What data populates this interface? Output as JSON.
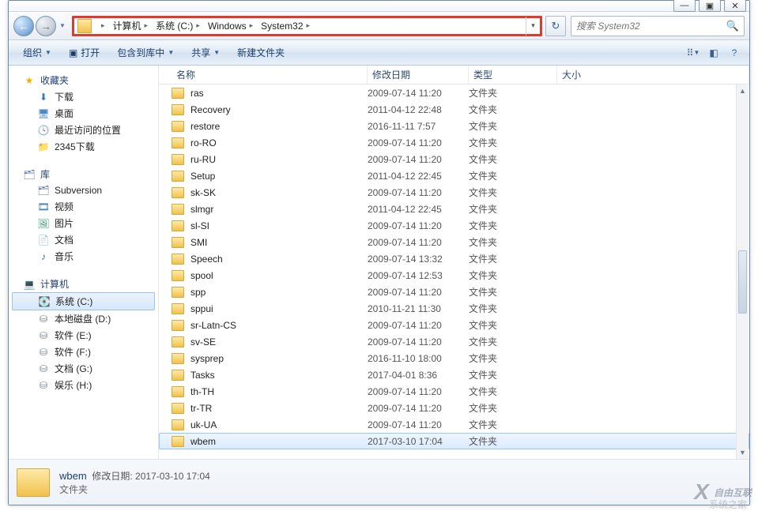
{
  "window_controls": {
    "min": "—",
    "max": "▣",
    "close": "✕"
  },
  "breadcrumbs": [
    "计算机",
    "系统 (C:)",
    "Windows",
    "System32"
  ],
  "search": {
    "placeholder": "搜索 System32"
  },
  "toolbar": {
    "organize": "组织",
    "open": "打开",
    "include": "包含到库中",
    "share": "共享",
    "newfolder": "新建文件夹"
  },
  "columns": {
    "name": "名称",
    "modified": "修改日期",
    "type": "类型",
    "size": "大小"
  },
  "sidebar": {
    "favorites": {
      "label": "收藏夹",
      "items": [
        "下载",
        "桌面",
        "最近访问的位置",
        "2345下载"
      ]
    },
    "libraries": {
      "label": "库",
      "items": [
        "Subversion",
        "视频",
        "图片",
        "文档",
        "音乐"
      ]
    },
    "computer": {
      "label": "计算机",
      "items": [
        "系统 (C:)",
        "本地磁盘 (D:)",
        "软件 (E:)",
        "软件 (F:)",
        "文档 (G:)",
        "娱乐 (H:)"
      ]
    }
  },
  "type_folder": "文件夹",
  "files": [
    {
      "n": "ras",
      "d": "2009-07-14 11:20"
    },
    {
      "n": "Recovery",
      "d": "2011-04-12 22:48"
    },
    {
      "n": "restore",
      "d": "2016-11-11 7:57"
    },
    {
      "n": "ro-RO",
      "d": "2009-07-14 11:20"
    },
    {
      "n": "ru-RU",
      "d": "2009-07-14 11:20"
    },
    {
      "n": "Setup",
      "d": "2011-04-12 22:45"
    },
    {
      "n": "sk-SK",
      "d": "2009-07-14 11:20"
    },
    {
      "n": "slmgr",
      "d": "2011-04-12 22:45"
    },
    {
      "n": "sl-SI",
      "d": "2009-07-14 11:20"
    },
    {
      "n": "SMI",
      "d": "2009-07-14 11:20"
    },
    {
      "n": "Speech",
      "d": "2009-07-14 13:32"
    },
    {
      "n": "spool",
      "d": "2009-07-14 12:53"
    },
    {
      "n": "spp",
      "d": "2009-07-14 11:20"
    },
    {
      "n": "sppui",
      "d": "2010-11-21 11:30"
    },
    {
      "n": "sr-Latn-CS",
      "d": "2009-07-14 11:20"
    },
    {
      "n": "sv-SE",
      "d": "2009-07-14 11:20"
    },
    {
      "n": "sysprep",
      "d": "2016-11-10 18:00"
    },
    {
      "n": "Tasks",
      "d": "2017-04-01 8:36"
    },
    {
      "n": "th-TH",
      "d": "2009-07-14 11:20"
    },
    {
      "n": "tr-TR",
      "d": "2009-07-14 11:20"
    },
    {
      "n": "uk-UA",
      "d": "2009-07-14 11:20"
    },
    {
      "n": "wbem",
      "d": "2017-03-10 17:04"
    }
  ],
  "selected_index": 21,
  "details": {
    "name": "wbem",
    "mod_label": "修改日期:",
    "mod_value": "2017-03-10 17:04",
    "type": "文件夹"
  },
  "watermark": {
    "line1": "自由互联",
    "line2": "系统之家"
  }
}
